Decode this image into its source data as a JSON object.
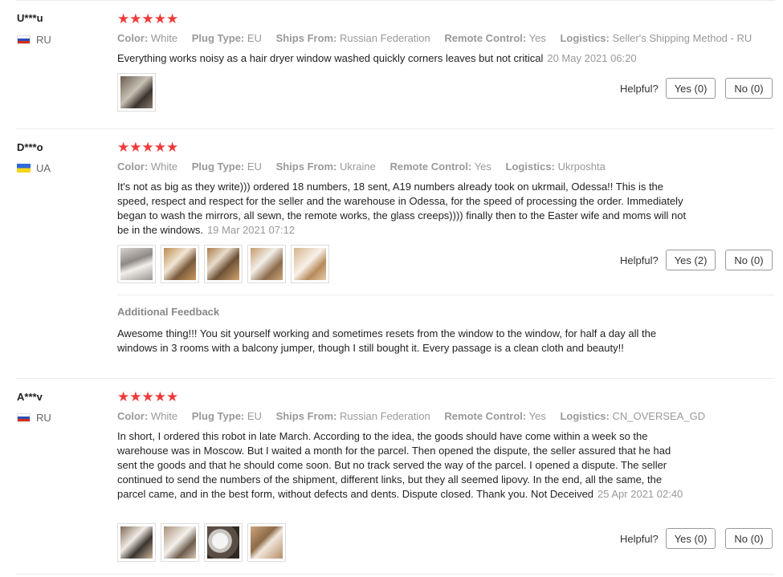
{
  "helpful_label": "Helpful?",
  "attr_keys": {
    "color": "Color:",
    "plug": "Plug Type:",
    "ships": "Ships From:",
    "remote": "Remote Control:",
    "logistics": "Logistics:"
  },
  "reviews": [
    {
      "user": "U***u",
      "country": "RU",
      "stars": "★★★★★",
      "color": "White",
      "plug": "EU",
      "ships": "Russian Federation",
      "remote": "Yes",
      "logistics": "Seller's Shipping Method - RU",
      "text": "Everything works noisy as a hair dryer window washed quickly corners leaves but not critical",
      "date": "20 May 2021 06:20",
      "yes": "Yes (0)",
      "no": "No (0)"
    },
    {
      "user": "D***o",
      "country": "UA",
      "stars": "★★★★★",
      "color": "White",
      "plug": "EU",
      "ships": "Ukraine",
      "remote": "Yes",
      "logistics": "Ukrposhta",
      "text": "It's not as big as they write))) ordered 18 numbers, 18 sent, A19 numbers already took on ukrmail, Odessa!! This is the speed, respect and respect for the seller and the warehouse in Odessa, for the speed of processing the order. Immediately began to wash the mirrors, all sewn, the remote works, the glass creeps)))) finally then to the Easter wife and moms will not be in the windows.",
      "date": "19 Mar 2021 07:12",
      "yes": "Yes (2)",
      "no": "No (0)",
      "additional_title": "Additional Feedback",
      "additional_text": "Awesome thing!!! You sit yourself working and sometimes resets from the window to the window, for half a day all the windows in 3 rooms with a balcony jumper, though I still bought it. Every passage is a clean cloth and beauty!!"
    },
    {
      "user": "A***v",
      "country": "RU",
      "stars": "★★★★★",
      "color": "White",
      "plug": "EU",
      "ships": "Russian Federation",
      "remote": "Yes",
      "logistics": "CN_OVERSEA_GD",
      "text": "In short, I ordered this robot in late March. According to the idea, the goods should have come within a week so the warehouse was in Moscow. But I waited a month for the parcel. Then opened the dispute, the seller assured that he had sent the goods and that he should come soon. But no track served the way of the parcel. I opened a dispute. The seller continued to send the numbers of the shipment, different links, but they all seemed lipovy. In the end, all the same, the parcel came, and in the best form, without defects and dents. Dispute closed. Thank you. Not Deceived",
      "date": "25 Apr 2021 02:40",
      "yes": "Yes (0)",
      "no": "No (0)"
    }
  ]
}
